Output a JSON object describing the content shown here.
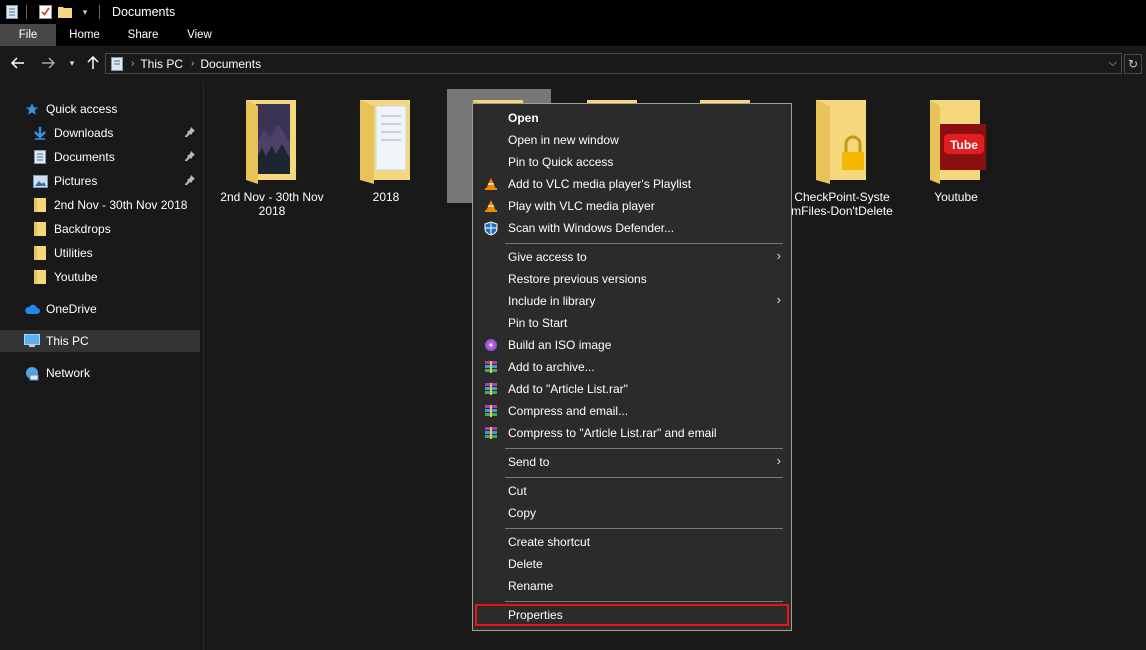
{
  "window": {
    "title": "Documents"
  },
  "ribbon": {
    "tabs": [
      "File",
      "Home",
      "Share",
      "View"
    ]
  },
  "address": {
    "crumbs": [
      "This PC",
      "Documents"
    ]
  },
  "sidebar": {
    "quick_access": "Quick access",
    "items": [
      "Downloads",
      "Documents",
      "Pictures",
      "2nd Nov - 30th Nov 2018",
      "Backdrops",
      "Utilities",
      "Youtube"
    ],
    "onedrive": "OneDrive",
    "this_pc": "This PC",
    "network": "Network"
  },
  "content": {
    "folders": [
      {
        "name": "2nd Nov - 30th Nov 2018"
      },
      {
        "name": "2018"
      },
      {
        "name": "CheckPoint-SystemFiles-Don'tDelete"
      },
      {
        "name": "Youtube"
      }
    ]
  },
  "context_menu": {
    "open": "Open",
    "open_new_window": "Open in new window",
    "pin_quick_access": "Pin to Quick access",
    "vlc_playlist": "Add to VLC media player's Playlist",
    "vlc_play": "Play with VLC media player",
    "defender": "Scan with Windows Defender...",
    "give_access": "Give access to",
    "restore": "Restore previous versions",
    "include_library": "Include in library",
    "pin_start": "Pin to Start",
    "build_iso": "Build an ISO image",
    "add_archive": "Add to archive...",
    "add_rar": "Add to \"Article List.rar\"",
    "compress_email": "Compress and email...",
    "compress_rar_email": "Compress to \"Article List.rar\" and email",
    "send_to": "Send to",
    "cut": "Cut",
    "copy": "Copy",
    "create_shortcut": "Create shortcut",
    "delete": "Delete",
    "rename": "Rename",
    "properties": "Properties"
  },
  "colors": {
    "highlight_border": "#e0161a",
    "folder": "#f5d77c"
  }
}
